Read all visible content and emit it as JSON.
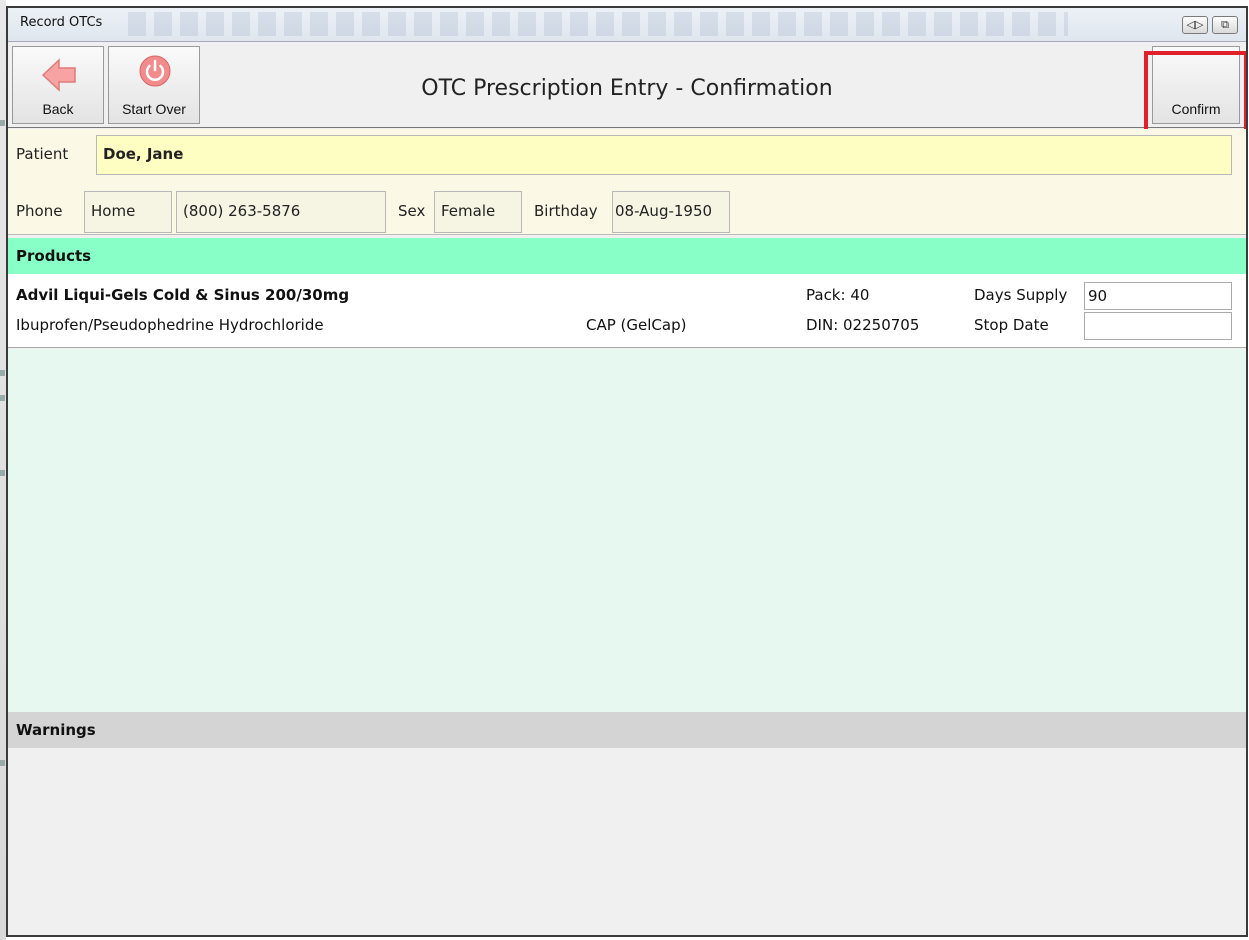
{
  "window": {
    "title": "Record OTCs"
  },
  "toolbar": {
    "back_label": "Back",
    "start_over_label": "Start Over",
    "page_title": "OTC Prescription Entry - Confirmation",
    "confirm_label": "Confirm"
  },
  "patient": {
    "patient_label": "Patient",
    "name": "Doe, Jane",
    "phone_label": "Phone",
    "phone_type": "Home",
    "phone_number": "(800) 263-5876",
    "sex_label": "Sex",
    "sex": "Female",
    "birthday_label": "Birthday",
    "birthday": "08-Aug-1950"
  },
  "products": {
    "header": "Products",
    "items": [
      {
        "name": "Advil Liqui-Gels Cold & Sinus 200/30mg",
        "generic": "Ibuprofen/Pseudophedrine Hydrochloride",
        "form": "CAP (GelCap)",
        "pack": "Pack: 40",
        "din": "DIN: 02250705",
        "days_supply_label": "Days Supply",
        "days_supply": "90",
        "stop_date_label": "Stop Date",
        "stop_date": ""
      }
    ]
  },
  "warnings": {
    "header": "Warnings"
  },
  "colors": {
    "accent_red": "#e0202a",
    "products_header": "#88ffc6",
    "patient_name_bg": "#fefdc2",
    "patient_panel_bg": "#fbf9e6",
    "products_body_bg": "#e6f8ef",
    "warnings_header": "#d4d4d4"
  }
}
